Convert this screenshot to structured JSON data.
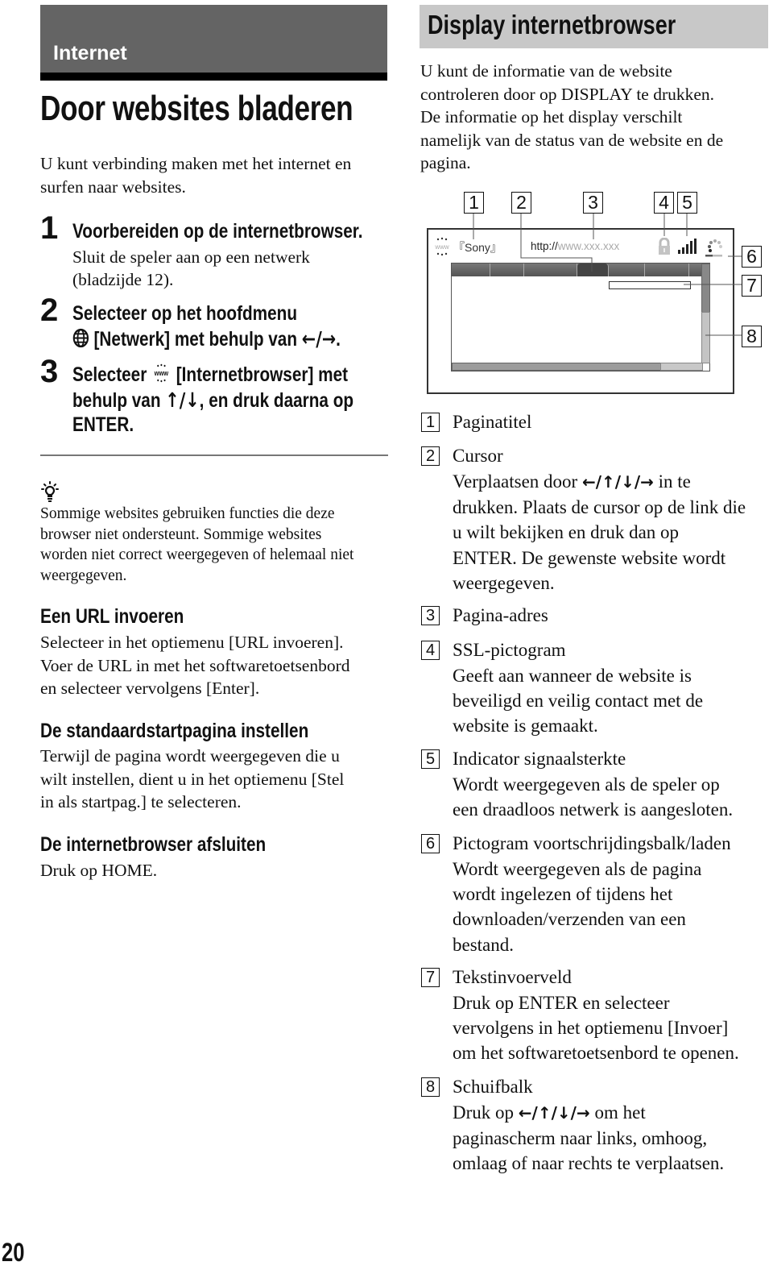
{
  "header": {
    "section_label": "Internet",
    "title": "Door websites bladeren"
  },
  "intro": "U kunt verbinding maken met het internet en surfen naar websites.",
  "steps": [
    {
      "number": "1",
      "title": "Voorbereiden op de internetbrowser.",
      "body": [
        "Sluit de speler aan op een netwerk",
        "(bladzijde 12)."
      ]
    },
    {
      "number": "2",
      "title_line1": "Selecteer op het hoofdmenu",
      "icon": "globe-icon",
      "title_line2_text": "[Netwerk] met behulp van",
      "arrows": "←/→",
      "end": "."
    },
    {
      "number": "3",
      "title_line1_pre": "Selecteer",
      "icon": "www-icon",
      "title_line1_post": "[Internetbrowser] met",
      "title_line2_pre": "behulp van",
      "arrows": "↑/↓",
      "title_line2_post": ", en druk daarna op",
      "title_line3": "ENTER."
    }
  ],
  "tip": {
    "icon": "lightbulb-icon",
    "lines": [
      "Sommige websites gebruiken functies die deze",
      "browser niet ondersteunt. Sommige websites",
      "worden niet correct weergegeven of helemaal niet",
      "weergegeven."
    ]
  },
  "subsections": [
    {
      "heading": "Een URL invoeren",
      "lines": [
        "Selecteer in het optiemenu [URL invoeren].",
        "Voer de URL in met het softwaretoetsenbord",
        "en selecteer vervolgens [Enter]."
      ]
    },
    {
      "heading": "De standaardstartpagina instellen",
      "lines": [
        "Terwijl de pagina wordt weergegeven die u",
        "wilt instellen, dient u in het optiemenu [Stel",
        "in als startpag.] te selecteren."
      ]
    },
    {
      "heading": "De internetbrowser afsluiten",
      "lines": [
        "Druk op HOME."
      ]
    }
  ],
  "display_section": {
    "title": "Display internetbrowser",
    "intro_lines": [
      "U kunt de informatie van de website",
      "controleren door op DISPLAY te drukken.",
      "De informatie op het display verschilt",
      "namelijk van de status van de website en de",
      "pagina."
    ],
    "diagram": {
      "page_title": "『Sony』",
      "url_prefix": "http://",
      "url_rest": "www.xxx.xxx",
      "www_icon_text": "www",
      "callouts": [
        "1",
        "2",
        "3",
        "4",
        "5",
        "6",
        "7",
        "8"
      ]
    }
  },
  "legend": [
    {
      "num": "1",
      "title": "Paginatitel",
      "desc": []
    },
    {
      "num": "2",
      "title": "Cursor",
      "desc_first_pre": "Verplaatsen door",
      "desc_first_arrows": "←/↑/↓/→",
      "desc_first_post": "in te",
      "desc": [
        "drukken. Plaats de cursor op de link die",
        "u wilt bekijken en druk dan op",
        "ENTER. De gewenste website wordt",
        "weergegeven."
      ]
    },
    {
      "num": "3",
      "title": "Pagina-adres",
      "desc": []
    },
    {
      "num": "4",
      "title": "SSL-pictogram",
      "desc": [
        "Geeft aan wanneer de website is",
        "beveiligd en veilig contact met de",
        "website is gemaakt."
      ]
    },
    {
      "num": "5",
      "title": "Indicator signaalsterkte",
      "desc": [
        "Wordt weergegeven als de speler op",
        "een draadloos netwerk is aangesloten."
      ]
    },
    {
      "num": "6",
      "title": "Pictogram voortschrijdingsbalk/laden",
      "desc": [
        "Wordt weergegeven als de pagina",
        "wordt ingelezen of tijdens het",
        "downloaden/verzenden van een",
        "bestand."
      ]
    },
    {
      "num": "7",
      "title": "Tekstinvoerveld",
      "desc": [
        "Druk op ENTER en selecteer",
        "vervolgens in het optiemenu [Invoer]",
        "om het softwaretoetsenbord te openen."
      ]
    },
    {
      "num": "8",
      "title": "Schuifbalk",
      "desc_first_pre": "Druk op",
      "desc_first_arrows": "←/↑/↓/→",
      "desc_first_post": "om het",
      "desc": [
        "paginascherm naar links, omhoog,",
        "omlaag of naar rechts te verplaatsen."
      ]
    }
  ],
  "page_number": "20"
}
